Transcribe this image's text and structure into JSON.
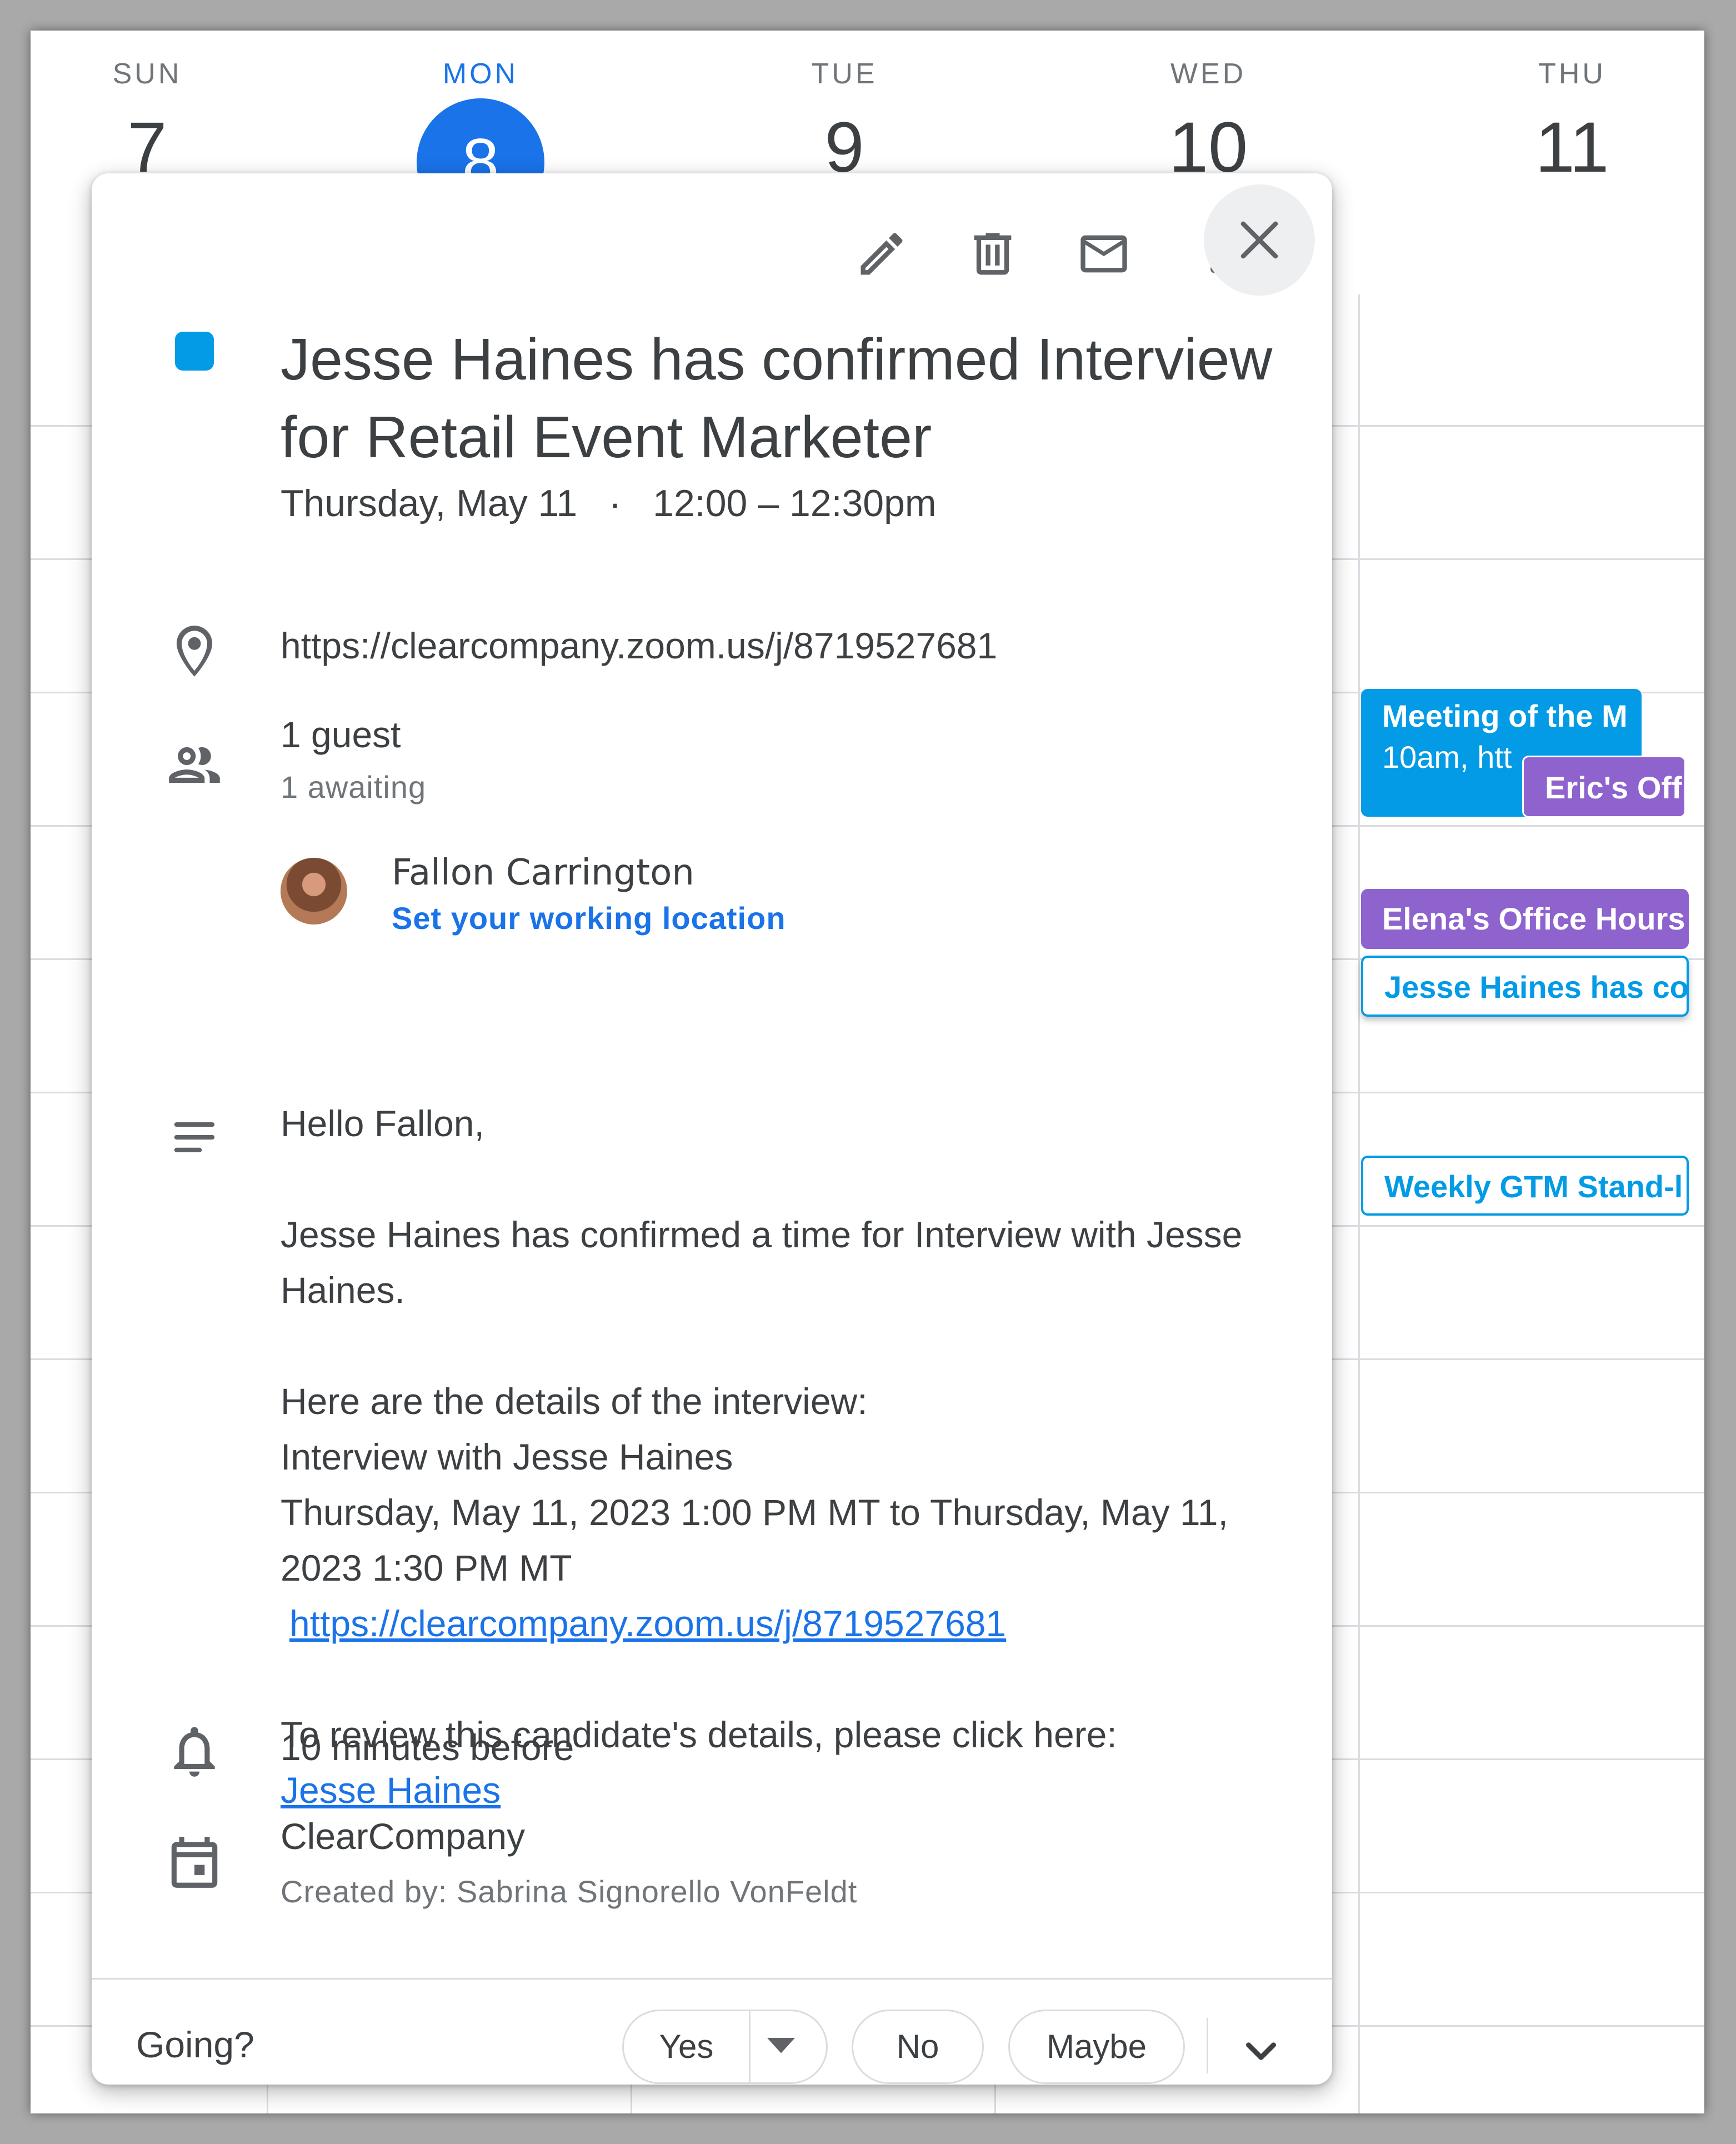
{
  "calendar": {
    "days": [
      {
        "dow": "SUN",
        "num": "7"
      },
      {
        "dow": "MON",
        "num": "8",
        "today": true
      },
      {
        "dow": "TUE",
        "num": "9"
      },
      {
        "dow": "WED",
        "num": "10"
      },
      {
        "dow": "THU",
        "num": "11"
      }
    ],
    "events": [
      {
        "line1": "Meeting of the M",
        "line2": "10am, htt",
        "color": "#039be5"
      },
      {
        "label": "Eric's Offi",
        "color": "#8e63ce"
      },
      {
        "label": "Elena's Office Hours",
        "color": "#8e63ce"
      },
      {
        "label": "Jesse Haines has co",
        "color": "#039be5"
      },
      {
        "label": "Weekly GTM Stand-l",
        "color": "#039be5"
      }
    ]
  },
  "popup": {
    "toolbar": {
      "edit_icon": "pencil-icon",
      "delete_icon": "trash-icon",
      "email_icon": "mail-icon",
      "more_icon": "more-vert-icon",
      "close_icon": "close-icon"
    },
    "event_color": "#039be5",
    "title": "Jesse Haines has confirmed Interview for Retail Event Marketer",
    "date": "Thursday, May 11",
    "separator": "·",
    "time": "12:00 – 12:30pm",
    "location": "https://clearcompany.zoom.us/j/8719527681",
    "guests": {
      "count": "1 guest",
      "status": "1 awaiting",
      "list": [
        {
          "name": "Fallon Carrington",
          "action": "Set your working location"
        }
      ]
    },
    "description": {
      "greeting": "Hello Fallon,",
      "p1": "Jesse Haines has confirmed a time for Interview with Jesse Haines.",
      "p2_l1": "Here are the details of the interview:",
      "p2_l2": "Interview with Jesse Haines",
      "p2_l3": "Thursday, May 11, 2023 1:00 PM MT to Thursday, May 11, 2023 1:30 PM MT",
      "p2_link": "https://clearcompany.zoom.us/j/8719527681",
      "p3": "To review this candidate's details, please click here:",
      "p3_link": "Jesse Haines"
    },
    "reminder": "10 minutes before",
    "calendar_name": "ClearCompany",
    "created_by": "Created by: Sabrina Signorello VonFeldt",
    "footer": {
      "going_label": "Going?",
      "yes": "Yes",
      "no": "No",
      "maybe": "Maybe"
    }
  },
  "colors": {
    "accent": "#1a73e8",
    "event_blue": "#039be5",
    "event_purple": "#8e63ce"
  }
}
